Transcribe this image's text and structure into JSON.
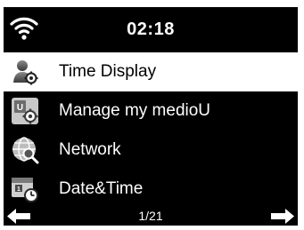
{
  "status_bar": {
    "time": "02:18",
    "wifi_icon": "wifi-icon"
  },
  "menu": {
    "items": [
      {
        "label": "Time Display",
        "icon": "person-gear-icon",
        "selected": true
      },
      {
        "label": "Manage my medioU",
        "icon": "device-gear-icon",
        "selected": false
      },
      {
        "label": "Network",
        "icon": "globe-search-icon",
        "selected": false
      },
      {
        "label": "Date&Time",
        "icon": "calendar-clock-icon",
        "selected": false
      }
    ]
  },
  "footer": {
    "page": "1/21",
    "prev_icon": "arrow-left-icon",
    "next_icon": "arrow-right-icon"
  },
  "colors": {
    "background": "#000000",
    "text": "#ffffff",
    "selection": "#ffffff",
    "selected_text": "#000000"
  }
}
